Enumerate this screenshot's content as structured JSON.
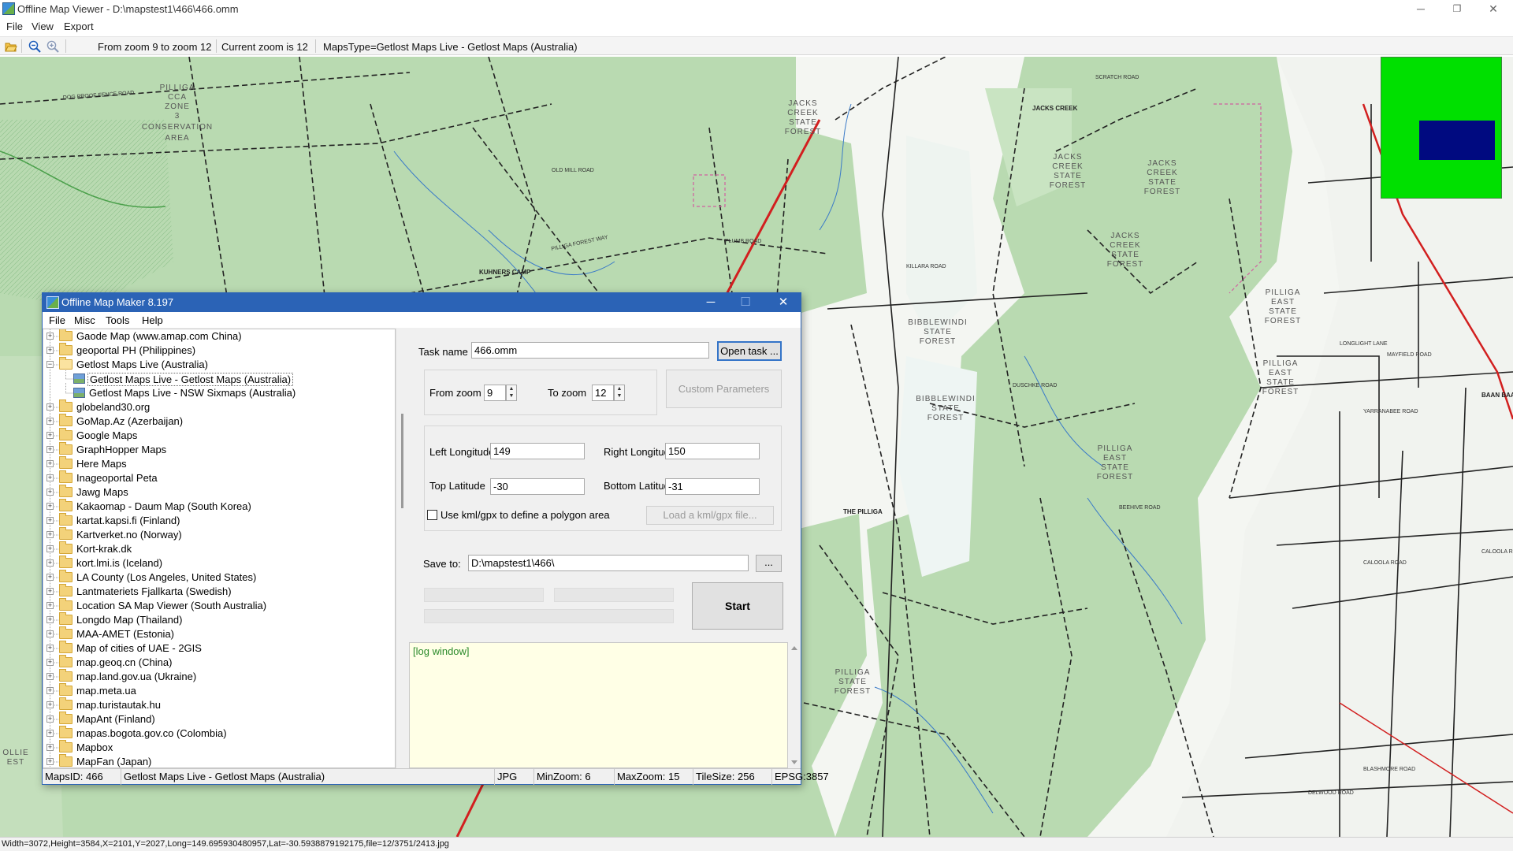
{
  "window": {
    "title": "Offline Map Viewer - D:\\mapstest1\\466\\466.omm",
    "menu": [
      "File",
      "View",
      "Export"
    ],
    "controls": {
      "minimize": "─",
      "restore": "❐",
      "close": "✕"
    }
  },
  "toolbar": {
    "zoom_range": "From zoom 9 to zoom 12",
    "current_zoom": "Current zoom is 12",
    "maps_type": "MapsType=Getlost Maps Live - Getlost Maps (Australia)"
  },
  "map": {
    "labels": [
      "PILLIGA CCA ZONE 3 CONSERVATION AREA",
      "JACKS CREEK STATE FOREST",
      "JACKS CREEK",
      "JACKS CREEK STATE FOREST",
      "JACKS CREEK STATE FOREST",
      "BIBBLEWINDI STATE FOREST",
      "BIBBLEWINDI STATE FOREST",
      "PILLIGA EAST STATE FOREST",
      "PILLIGA EAST STATE FOREST",
      "PILLIGA EAST STATE FOREST",
      "PILLIGA STATE FOREST",
      "THE PILLIGA",
      "KUHNERS CAMP",
      "BAAN BAA",
      "PILLIGA FOREST WAY",
      "YARRANABEE ROAD",
      "CALOOLA ROAD",
      "MAYFIELD ROAD",
      "SCRATCH ROAD",
      "KILLARA ROAD",
      "DOG PROOF FENCE ROAD",
      "OLD MILL ROAD",
      "PLUMB ROAD",
      "DUSCHKE ROAD",
      "BEEHIVE ROAD",
      "LONGLIGHT LANE",
      "BLASHMORE ROAD",
      "DELWOOD ROAD"
    ],
    "colors": {
      "forest": "#b9dab1",
      "forest_dark": "#a6cfa0",
      "open": "#f4f6f2",
      "road": "#1a1a1a",
      "highway": "#d21f1f"
    }
  },
  "minimap": {
    "colors": {
      "background": "#00e000",
      "viewport": "#000a80"
    }
  },
  "statusbar": {
    "text": "Width=3072,Height=3584,X=2101,Y=2027,Long=149.695930480957,Lat=-30.5938879192175,file=12/3751/2413.jpg"
  },
  "dialog": {
    "title": "Offline Map Maker 8.197",
    "controls": {
      "minimize": "─",
      "maximize": "☐",
      "close": "✕"
    },
    "menu": [
      "File",
      "Misc",
      "Tools",
      "Help"
    ],
    "tree": [
      {
        "label": "Gaode Map (www.amap.com China)",
        "level": 0,
        "type": "folder",
        "expanded": false
      },
      {
        "label": "geoportal PH (Philippines)",
        "level": 0,
        "type": "folder",
        "expanded": false
      },
      {
        "label": "Getlost Maps Live (Australia)",
        "level": 0,
        "type": "folder",
        "expanded": true
      },
      {
        "label": "Getlost Maps Live - Getlost Maps (Australia)",
        "level": 1,
        "type": "map",
        "selected": true
      },
      {
        "label": "Getlost Maps Live - NSW Sixmaps (Australia)",
        "level": 1,
        "type": "map"
      },
      {
        "label": "globeland30.org",
        "level": 0,
        "type": "folder",
        "expanded": false
      },
      {
        "label": "GoMap.Az (Azerbaijan)",
        "level": 0,
        "type": "folder",
        "expanded": false
      },
      {
        "label": "Google Maps",
        "level": 0,
        "type": "folder",
        "expanded": false
      },
      {
        "label": "GraphHopper Maps",
        "level": 0,
        "type": "folder",
        "expanded": false
      },
      {
        "label": "Here Maps",
        "level": 0,
        "type": "folder",
        "expanded": false
      },
      {
        "label": "Inageoportal Peta",
        "level": 0,
        "type": "folder",
        "expanded": false
      },
      {
        "label": "Jawg Maps",
        "level": 0,
        "type": "folder",
        "expanded": false
      },
      {
        "label": "Kakaomap - Daum Map (South Korea)",
        "level": 0,
        "type": "folder",
        "expanded": false
      },
      {
        "label": "kartat.kapsi.fi (Finland)",
        "level": 0,
        "type": "folder",
        "expanded": false
      },
      {
        "label": "Kartverket.no (Norway)",
        "level": 0,
        "type": "folder",
        "expanded": false
      },
      {
        "label": "Kort-krak.dk",
        "level": 0,
        "type": "folder",
        "expanded": false
      },
      {
        "label": "kort.lmi.is (Iceland)",
        "level": 0,
        "type": "folder",
        "expanded": false
      },
      {
        "label": "LA County (Los Angeles, United States)",
        "level": 0,
        "type": "folder",
        "expanded": false
      },
      {
        "label": "Lantmateriets Fjallkarta (Swedish)",
        "level": 0,
        "type": "folder",
        "expanded": false
      },
      {
        "label": "Location SA Map Viewer (South Australia)",
        "level": 0,
        "type": "folder",
        "expanded": false
      },
      {
        "label": "Longdo Map (Thailand)",
        "level": 0,
        "type": "folder",
        "expanded": false
      },
      {
        "label": "MAA-AMET (Estonia)",
        "level": 0,
        "type": "folder",
        "expanded": false
      },
      {
        "label": "Map of cities of UAE - 2GIS",
        "level": 0,
        "type": "folder",
        "expanded": false
      },
      {
        "label": "map.geoq.cn (China)",
        "level": 0,
        "type": "folder",
        "expanded": false
      },
      {
        "label": "map.land.gov.ua (Ukraine)",
        "level": 0,
        "type": "folder",
        "expanded": false
      },
      {
        "label": "map.meta.ua",
        "level": 0,
        "type": "folder",
        "expanded": false
      },
      {
        "label": "map.turistautak.hu",
        "level": 0,
        "type": "folder",
        "expanded": false
      },
      {
        "label": "MapAnt (Finland)",
        "level": 0,
        "type": "folder",
        "expanded": false
      },
      {
        "label": "mapas.bogota.gov.co (Colombia)",
        "level": 0,
        "type": "folder",
        "expanded": false
      },
      {
        "label": "Mapbox",
        "level": 0,
        "type": "folder",
        "expanded": false
      },
      {
        "label": "MapFan (Japan)",
        "level": 0,
        "type": "folder",
        "expanded": false
      }
    ],
    "task": {
      "label": "Task name",
      "value": "466.omm",
      "open_button": "Open task ..."
    },
    "zoom": {
      "from_label": "From zoom",
      "from_value": "9",
      "to_label": "To zoom",
      "to_value": "12",
      "custom_button": "Custom Parameters"
    },
    "bounds": {
      "left_label": "Left Longitude",
      "left_value": "149",
      "right_label": "Right Longitude",
      "right_value": "150",
      "top_label": "Top Latitude",
      "top_value": "-30",
      "bottom_label": "Bottom Latitude",
      "bottom_value": "-31",
      "kml_label": "Use kml/gpx to define a polygon area",
      "kml_button": "Load a kml/gpx file..."
    },
    "save": {
      "label": "Save to:",
      "value": "D:\\mapstest1\\466\\",
      "browse_button": "...",
      "start_button": "Start"
    },
    "log": {
      "text": "[log window]"
    },
    "status": {
      "maps_id": "MapsID: 466",
      "maps_name": "Getlost Maps Live - Getlost Maps (Australia)",
      "format": "JPG",
      "min_zoom": "MinZoom: 6",
      "max_zoom": "MaxZoom: 15",
      "tile_size": "TileSize: 256",
      "epsg": "EPSG:3857"
    }
  }
}
